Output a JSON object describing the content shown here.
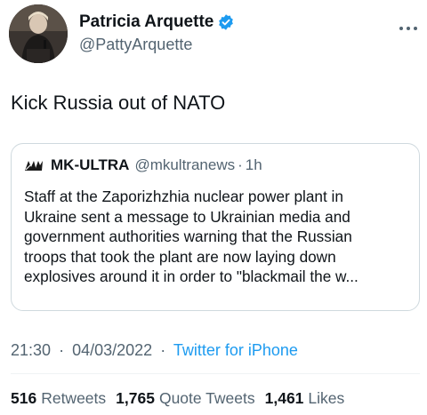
{
  "author": {
    "display_name": "Patricia Arquette",
    "handle": "@PattyArquette",
    "verified": true
  },
  "tweet": {
    "text": "Kick Russia out of NATO",
    "time": "21:30",
    "date": "04/03/2022",
    "source": "Twitter for iPhone",
    "separator": "·"
  },
  "quoted_tweet": {
    "display_name": "MK-ULTRA",
    "handle": "@mkultranews",
    "separator": "·",
    "age": "1h",
    "text": "Staff at the Zaporizhzhia nuclear power plant in\nUkraine sent a message to Ukrainian media and\ngovernment authorities warning that the Russian\ntroops that took the plant are now laying down\nexplosives around it in order to \"blackmail the w..."
  },
  "stats": {
    "retweets": {
      "count": "516",
      "label": "Retweets"
    },
    "quote_tweets": {
      "count": "1,765",
      "label": "Quote Tweets"
    },
    "likes": {
      "count": "1,461",
      "label": "Likes"
    }
  },
  "colors": {
    "link": "#1d9bf0",
    "secondary_text": "#536471",
    "border": "#cfd9de"
  },
  "icons": {
    "verified": "verified-badge-icon",
    "more": "more-options-icon",
    "quoted_logo": "mk-ultra-logo-icon"
  }
}
